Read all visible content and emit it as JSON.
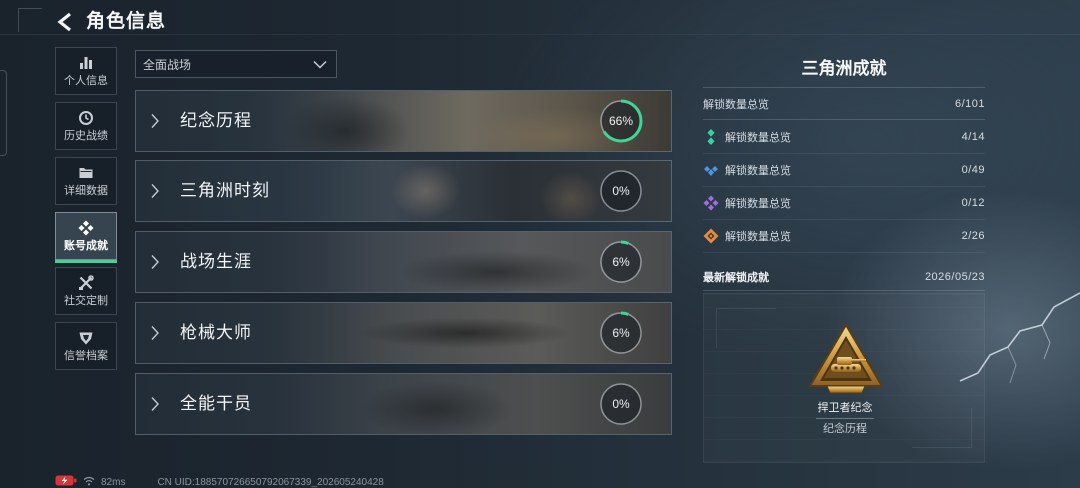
{
  "theme": {
    "accent": "#3ed598"
  },
  "header": {
    "title": "角色信息",
    "back_icon": "back-arrow-icon"
  },
  "sidebar": {
    "items": [
      {
        "label": "个人信息",
        "icon": "bar-chart-icon",
        "active": false
      },
      {
        "label": "历史战绩",
        "icon": "history-clock-icon",
        "active": false
      },
      {
        "label": "详细数据",
        "icon": "folder-icon",
        "active": false
      },
      {
        "label": "账号成就",
        "icon": "achievement-icon",
        "active": true
      },
      {
        "label": "社交定制",
        "icon": "tools-icon",
        "active": false
      },
      {
        "label": "信誉档案",
        "icon": "shield-icon",
        "active": false
      }
    ]
  },
  "filter": {
    "selected": "全面战场",
    "icon": "chevron-down-icon"
  },
  "categories": [
    {
      "label": "纪念历程",
      "progress": "66%"
    },
    {
      "label": "三角洲时刻",
      "progress": "0%"
    },
    {
      "label": "战场生涯",
      "progress": "6%"
    },
    {
      "label": "枪械大师",
      "progress": "6%"
    },
    {
      "label": "全能干员",
      "progress": "0%"
    }
  ],
  "achievements": {
    "title": "三角洲成就",
    "total": {
      "label": "解锁数量总览",
      "value": "6/101"
    },
    "tiers": [
      {
        "label": "解锁数量总览",
        "value": "4/14",
        "icon": "green-tier-icon",
        "color": "#35d49c"
      },
      {
        "label": "解锁数量总览",
        "value": "0/49",
        "icon": "blue-tier-icon",
        "color": "#4f93e6"
      },
      {
        "label": "解锁数量总览",
        "value": "0/12",
        "icon": "purple-tier-icon",
        "color": "#a06ee0"
      },
      {
        "label": "解锁数量总览",
        "value": "2/26",
        "icon": "orange-tier-icon",
        "color": "#e88a3c"
      }
    ],
    "latest": {
      "label": "最新解锁成就",
      "date": "2026/05/23",
      "name": "捍卫者纪念",
      "category": "纪念历程",
      "badge_icon": "defender-badge-icon"
    }
  },
  "status_bar": {
    "battery_icon": "battery-charging-icon",
    "battery_color": "#d8343a",
    "wifi_icon": "wifi-icon",
    "ping": "82ms",
    "uid": "CN UID:188570726650792067339_202605240428"
  }
}
